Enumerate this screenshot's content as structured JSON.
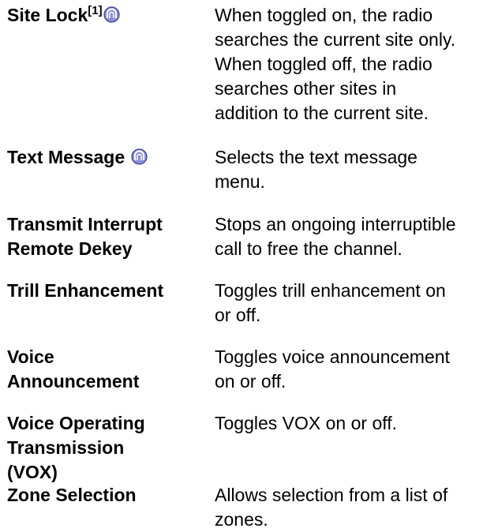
{
  "rows": [
    {
      "term": "Site Lock",
      "superscript": "[1]",
      "has_icon": true,
      "lines": [
        "When toggled on, the radio",
        "searches the current site only.",
        "When toggled off, the radio",
        "searches other sites in",
        "addition to the current site."
      ]
    },
    {
      "term": "Text Message",
      "has_icon": true,
      "lines": [
        "Selects the text message",
        "menu."
      ]
    },
    {
      "term_lines": [
        "Transmit Interrupt",
        "Remote Dekey"
      ],
      "lines": [
        "Stops an ongoing interruptible",
        "call to free the channel."
      ]
    },
    {
      "term": "Trill Enhancement",
      "lines": [
        "Toggles trill enhancement on",
        "or off."
      ]
    },
    {
      "term_lines": [
        "Voice",
        "Announcement"
      ],
      "lines": [
        "Toggles voice announcement",
        "on or off."
      ]
    },
    {
      "term_lines": [
        "Voice Operating",
        "Transmission",
        "(VOX)"
      ],
      "lines": [
        "Toggles VOX on or off."
      ]
    },
    {
      "term": "Zone Selection",
      "lines": [
        "Allows selection from a list of",
        "zones."
      ]
    }
  ],
  "icon_name": "radio-feature-icon",
  "colors": {
    "text": "#000000",
    "icon_fill": "#8a8fd6",
    "icon_stroke": "#3b3f8f"
  }
}
